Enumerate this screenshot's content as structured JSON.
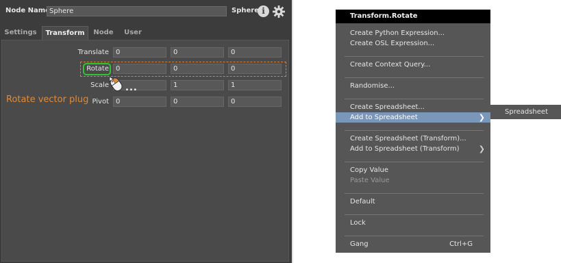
{
  "node_editor": {
    "node_name_label": "Node Name",
    "node_name_value": "Sphere",
    "node_type": "Sphere",
    "tabs": [
      {
        "label": "Settings"
      },
      {
        "label": "Transform"
      },
      {
        "label": "Node"
      },
      {
        "label": "User"
      }
    ],
    "active_tab": "Transform",
    "plugs": [
      {
        "label": "Translate",
        "values": [
          "0",
          "0",
          "0"
        ]
      },
      {
        "label": "Rotate",
        "values": [
          "0",
          "0",
          "0"
        ]
      },
      {
        "label": "Scale",
        "values": [
          "1",
          "1",
          "1"
        ]
      },
      {
        "label": "Pivot",
        "values": [
          "0",
          "0",
          "0"
        ]
      }
    ],
    "annotation": "Rotate vector plug",
    "ellipsis": "...",
    "accent_color": "#e08a38",
    "highlight_color": "#2ec72e"
  },
  "context_menu": {
    "title": "Transform.Rotate",
    "items": [
      {
        "label": "Create Python Expression..."
      },
      {
        "label": "Create OSL Expression..."
      },
      {
        "label": "Create Context Query..."
      },
      {
        "label": "Randomise..."
      },
      {
        "label": "Create Spreadsheet..."
      },
      {
        "label": "Add to Spreadsheet",
        "submenu": true,
        "highlighted": true
      },
      {
        "label": "Create Spreadsheet (Transform)..."
      },
      {
        "label": "Add to Spreadsheet (Transform)",
        "submenu": true
      },
      {
        "label": "Copy Value"
      },
      {
        "label": "Paste Value",
        "disabled": true
      },
      {
        "label": "Default"
      },
      {
        "label": "Lock"
      },
      {
        "label": "Gang",
        "shortcut": "Ctrl+G"
      }
    ],
    "highlight_color": "#7a96b8"
  },
  "submenu": {
    "items": [
      {
        "label": "Spreadsheet"
      }
    ]
  }
}
